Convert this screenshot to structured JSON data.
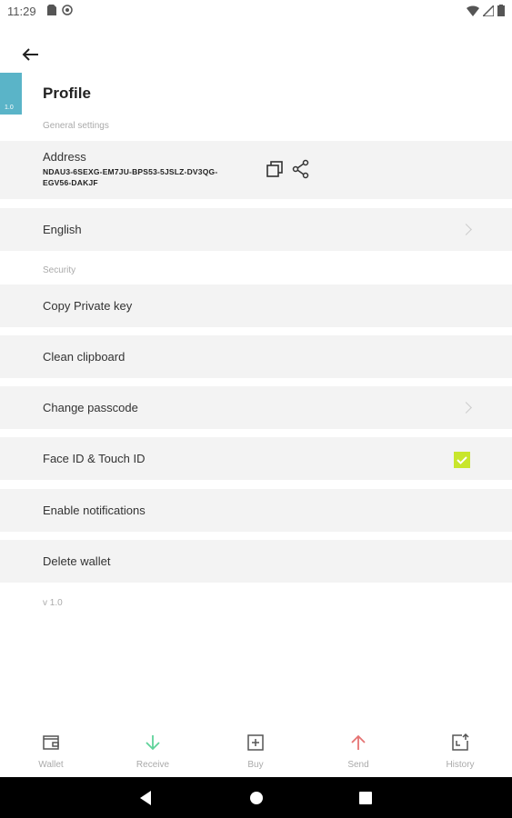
{
  "status_bar": {
    "time": "11:29"
  },
  "header": {
    "title": "Profile",
    "badge": "1.0"
  },
  "sections": {
    "general": "General settings",
    "security": "Security"
  },
  "address": {
    "label": "Address",
    "value": "NDAU3-6SEXG-EM7JU-BPS53-5JSLZ-DV3QG-EGV56-DAKJF"
  },
  "rows": {
    "language": "English",
    "copy_private_key": "Copy Private key",
    "clean_clipboard": "Clean clipboard",
    "change_passcode": "Change passcode",
    "face_id": "Face ID & Touch ID",
    "notifications": "Enable notifications",
    "delete_wallet": "Delete wallet"
  },
  "face_id_enabled": true,
  "version": "v 1.0",
  "tabs": [
    {
      "label": "Wallet",
      "icon": "wallet-icon",
      "color": "#555555"
    },
    {
      "label": "Receive",
      "icon": "arrow-down-icon",
      "color": "#5fd39a"
    },
    {
      "label": "Buy",
      "icon": "buy-icon",
      "color": "#555555"
    },
    {
      "label": "Send",
      "icon": "arrow-up-icon",
      "color": "#e57373"
    },
    {
      "label": "History",
      "icon": "history-icon",
      "color": "#555555"
    }
  ],
  "colors": {
    "accent_check": "#c8e62c",
    "badge": "#5ab4c8"
  }
}
